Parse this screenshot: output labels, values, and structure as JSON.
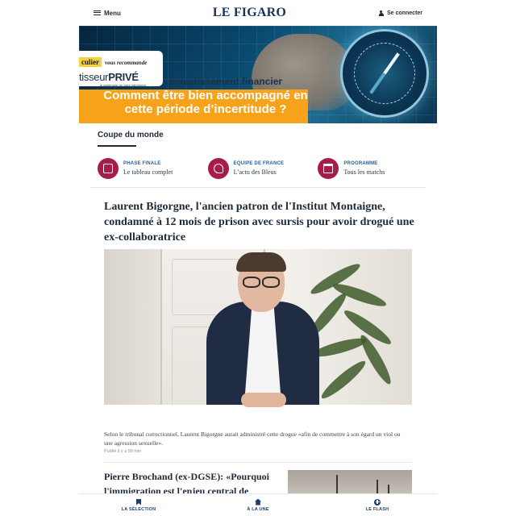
{
  "header": {
    "menu_label": "Menu",
    "logo": "LE FIGARO",
    "login_label": "Se connecter"
  },
  "ad": {
    "brand": "culier",
    "recommande": "vous recommande",
    "partner_name_light": "tisseur",
    "partner_name_bold": "PRIVÉ",
    "partner_tagline": "le partenaire de votre patrimoine",
    "headline": "Investissement financier",
    "subheadline": "Comment être bien accompagné en cette période d’incertitude ?"
  },
  "coupe_du_monde": {
    "title": "Coupe du monde",
    "items": [
      {
        "label": "PHASE FINALE",
        "sub": "Le tableau complet",
        "icon": "bracket-icon"
      },
      {
        "label": "EQUIPE DE FRANCE",
        "sub": "L’actu des Bleus",
        "icon": "rooster-icon"
      },
      {
        "label": "PROGRAMME",
        "sub": "Tous les matchs",
        "icon": "calendar-icon"
      }
    ]
  },
  "main_article": {
    "headline": "Laurent Bigorgne, l'ancien patron de l'Institut Montaigne, condamné à 12 mois de prison avec sursis pour avoir drogué une ex-collaboratrice",
    "caption": "Selon le tribunal correctionnel, Laurent Bigorgne aurait administré cette drogue «afin de commettre à son égard un viol ou une agression sexuelle».",
    "time": "Publié il y a 58 min"
  },
  "second_article": {
    "headline": "Pierre Brochand (ex-DGSE): «Pourquoi l'immigration est l'enjeu central de"
  },
  "bottom_nav": {
    "items": [
      {
        "label": "LA SÉLECTION",
        "icon": "bookmark-icon"
      },
      {
        "label": "À LA UNE",
        "icon": "home-icon"
      },
      {
        "label": "LE FLASH",
        "icon": "plus-circle-icon"
      }
    ]
  },
  "colors": {
    "brand_navy": "#16335a",
    "accent_crimson": "#a61c4b",
    "ad_orange": "#f6a21b",
    "link_blue": "#2a5d95"
  }
}
